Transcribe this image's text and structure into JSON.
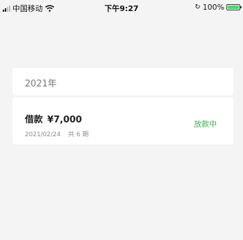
{
  "status_bar": {
    "carrier": "中国移动",
    "time": "下午9:27",
    "battery": "100%"
  },
  "year_section": {
    "label": "2021年"
  },
  "loan": {
    "title": "借款",
    "amount": "¥7,000",
    "date": "2021/02/24",
    "terms": "共 6 期",
    "status": "放款中",
    "status_color": "#3eae4a"
  }
}
